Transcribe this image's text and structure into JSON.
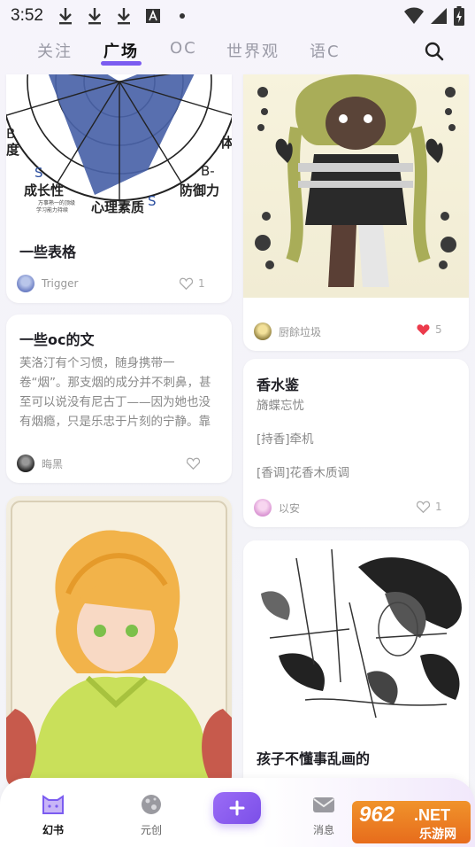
{
  "status_bar": {
    "time": "3:52"
  },
  "tabs": [
    {
      "label": "关注",
      "active": false
    },
    {
      "label": "广场",
      "active": true
    },
    {
      "label": "OC",
      "active": false
    },
    {
      "label": "世界观",
      "active": false
    },
    {
      "label": "语C",
      "active": false
    }
  ],
  "left_column": [
    {
      "type": "image",
      "image_labels": {
        "left": "B",
        "degree": "度",
        "s1": "S",
        "growth": "成长性",
        "small1": "万事熟一的顶级",
        "small2": "学习能力持续",
        "psych": "心理素质",
        "s2": "S",
        "bminus": "B-",
        "defense": "防御力",
        "body": "体"
      },
      "title": "一些表格",
      "author": "Trigger",
      "likes": "1"
    },
    {
      "type": "text",
      "title": "一些oc的文",
      "body": "芙洛汀有个习惯，随身携带一卷“烟”。那支烟的成分并不刺鼻，甚至可以说没有尼古丁——因为她也没有烟瘾，只是乐忠于片刻的宁静。靠在街角长椅旁任倦怠…",
      "author": "晦黑",
      "likes": ""
    },
    {
      "type": "image",
      "description_icon": "portrait-illustration"
    }
  ],
  "right_column": [
    {
      "type": "image",
      "author": "厨餘垃圾",
      "likes": "5",
      "liked": true
    },
    {
      "type": "text",
      "title": "香水鉴",
      "subtitle": "旖蝶忘忧",
      "line1": "[持香]牵机",
      "line2": "[香调]花香木质调",
      "author": "以安",
      "likes": "1"
    },
    {
      "type": "image",
      "title": "孩子不懂事乱画的"
    }
  ],
  "bottom_nav": {
    "items": [
      {
        "label": "幻书",
        "active": true
      },
      {
        "label": "元创",
        "active": false
      },
      {
        "label": "消息",
        "active": false
      }
    ]
  },
  "watermark": {
    "top": "962",
    "net": ".NET",
    "bottom": "乐游网"
  },
  "colors": {
    "accent": "#7b5cf0",
    "like_red": "#ec3b4c"
  }
}
